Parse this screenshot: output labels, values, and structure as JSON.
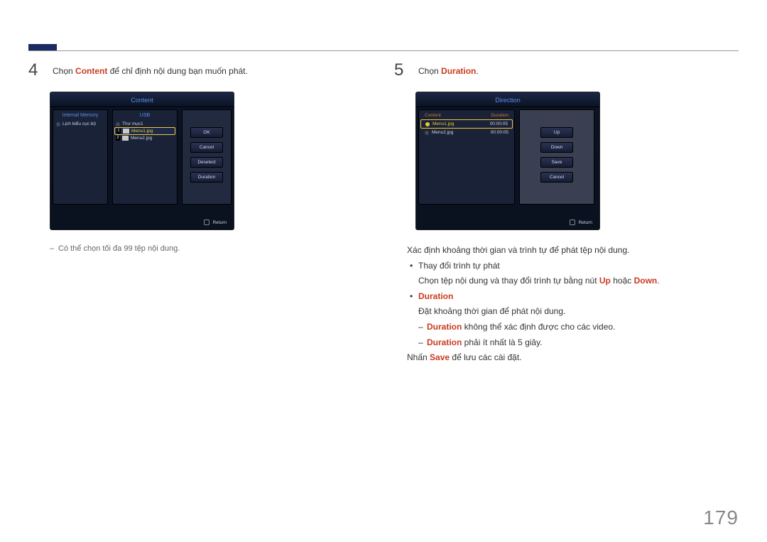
{
  "page_number": "179",
  "step4": {
    "num": "4",
    "prefix": "Chọn ",
    "hl": "Content",
    "suffix": " để chỉ định nội dung bạn muốn phát.",
    "note": "Có thể chọn tối đa 99 tệp nội dung."
  },
  "screen4": {
    "title": "Content",
    "left_tab": "Internal Memory",
    "mid_tab": "USB",
    "left_item": "Lịch biểu cục bộ",
    "folder": "Thư mục1",
    "item1_idx": "1",
    "item1": "Menu1.jpg",
    "item2_idx": "2",
    "item2": "Menu2.jpg",
    "btn_ok": "OK",
    "btn_cancel": "Cancel",
    "btn_deselect": "Deselect",
    "btn_duration": "Duration",
    "return": "Return"
  },
  "step5": {
    "num": "5",
    "prefix": "Chọn ",
    "hl": "Duration",
    "suffix": "."
  },
  "screen5": {
    "title": "Direction",
    "left_tab": "Content",
    "right_tab": "Duration",
    "item1": "Menu1.jpg",
    "dur1": "00:00:05",
    "item2": "Menu2.jpg",
    "dur2": "00:00:05",
    "btn_up": "Up",
    "btn_down": "Down",
    "btn_save": "Save",
    "btn_cancel": "Cancel",
    "return": "Return"
  },
  "body5": {
    "l1": "Xác định khoảng thời gian và trình tự để phát tệp nội dung.",
    "l2": "Thay đổi trình tự phát",
    "l3_a": "Chọn tệp nội dung và thay đổi trình tự bằng nút ",
    "l3_up": "Up",
    "l3_mid": " hoặc ",
    "l3_down": "Down",
    "l3_z": ".",
    "l4": "Duration",
    "l5": "Đặt khoảng thời gian để phát nội dung.",
    "l6_hl": "Duration",
    "l6_rest": " không thể xác định được cho các video.",
    "l7_hl": "Duration",
    "l7_rest": " phải ít nhất là 5 giây.",
    "l8_a": "Nhấn ",
    "l8_hl": "Save",
    "l8_z": " để lưu các cài đặt."
  }
}
